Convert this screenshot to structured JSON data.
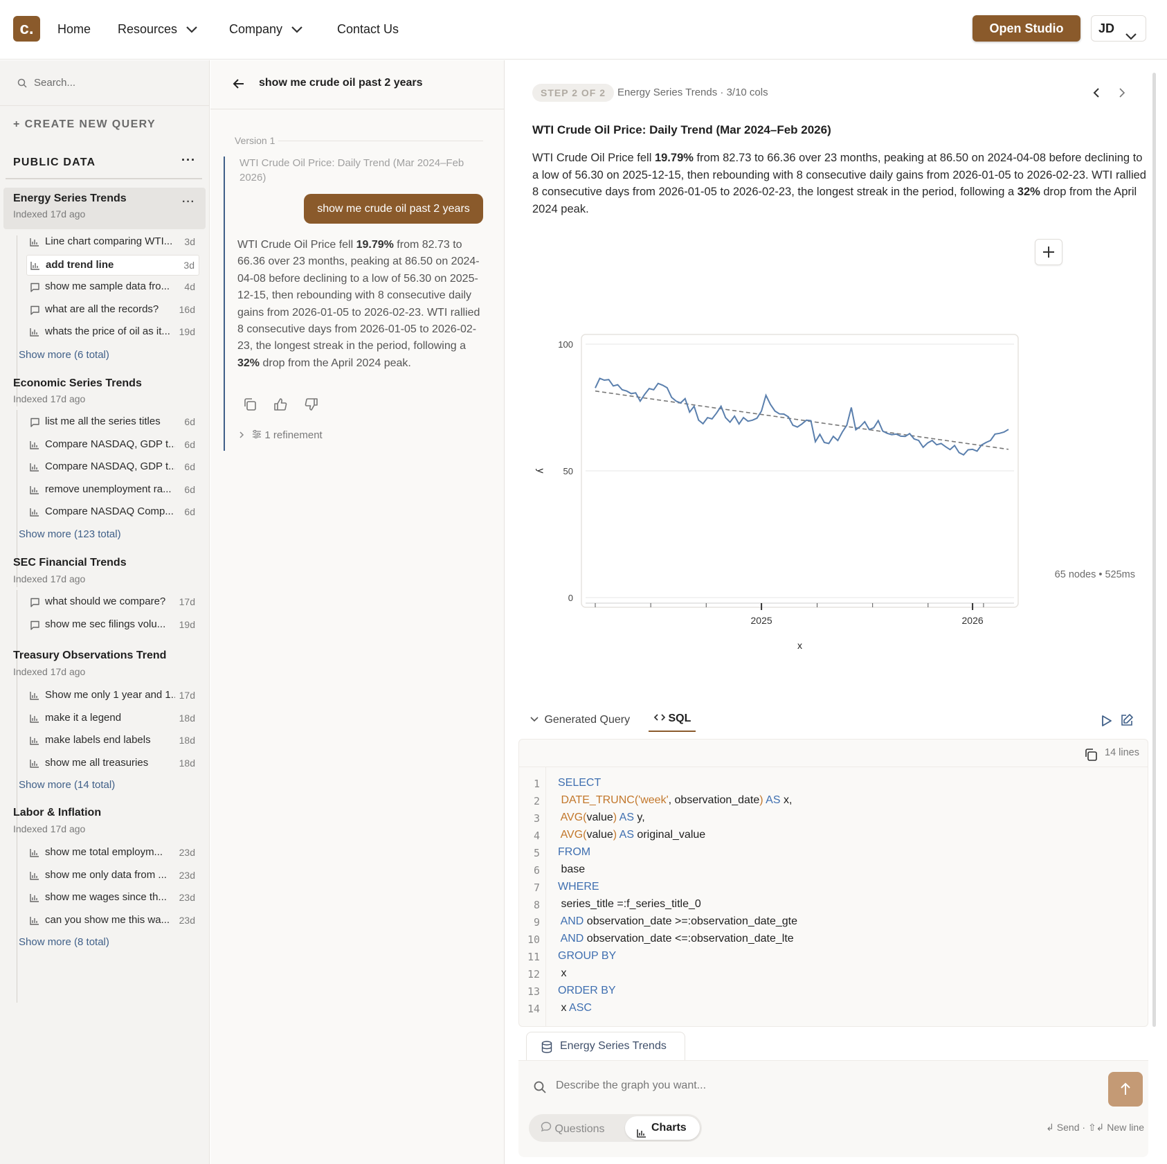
{
  "nav": {
    "logo": "c.",
    "home": "Home",
    "resources": "Resources",
    "company": "Company",
    "contact": "Contact Us",
    "open_studio": "Open Studio",
    "user_initials": "JD"
  },
  "sidebar": {
    "search_placeholder": "Search...",
    "create_label": "+ CREATE NEW QUERY",
    "section_title": "PUBLIC DATA",
    "section_more": "···",
    "groups": [
      {
        "title": "Energy Series Trends",
        "subtitle": "Indexed 17d ago",
        "more": "···",
        "items": [
          {
            "label": "Line chart comparing WTI...",
            "age": "3d",
            "icon": "chart-icon"
          },
          {
            "label": "add trend line",
            "age": "3d",
            "icon": "chart-icon"
          },
          {
            "label": "show me sample data fro...",
            "age": "4d",
            "icon": "comment-icon"
          },
          {
            "label": "what are all the records?",
            "age": "16d",
            "icon": "comment-icon"
          },
          {
            "label": "whats the price of oil as it...",
            "age": "19d",
            "icon": "chart-icon"
          }
        ],
        "show_more": "Show more (6 total)"
      },
      {
        "title": "Economic Series Trends",
        "subtitle": "Indexed 17d ago",
        "items": [
          {
            "label": "list me all the series titles",
            "age": "6d",
            "icon": "comment-icon"
          },
          {
            "label": "Compare NASDAQ, GDP t...",
            "age": "6d",
            "icon": "chart-icon"
          },
          {
            "label": "Compare NASDAQ, GDP t...",
            "age": "6d",
            "icon": "chart-icon"
          },
          {
            "label": "remove unemployment ra...",
            "age": "6d",
            "icon": "chart-icon"
          },
          {
            "label": "Compare NASDAQ Comp...",
            "age": "6d",
            "icon": "chart-icon"
          }
        ],
        "show_more": "Show more (123 total)"
      },
      {
        "title": "SEC Financial Trends",
        "subtitle": "Indexed 17d ago",
        "items": [
          {
            "label": "what should we compare?",
            "age": "17d",
            "icon": "comment-icon"
          },
          {
            "label": "show me sec filings volu...",
            "age": "19d",
            "icon": "comment-icon"
          }
        ]
      },
      {
        "title": "Treasury Observations Trend",
        "subtitle": "Indexed 17d ago",
        "items": [
          {
            "label": "Show me only 1 year and 1...",
            "age": "17d",
            "icon": "chart-icon"
          },
          {
            "label": "make it a legend",
            "age": "18d",
            "icon": "chart-icon"
          },
          {
            "label": "make labels end labels",
            "age": "18d",
            "icon": "chart-icon"
          },
          {
            "label": "show me all treasuries",
            "age": "18d",
            "icon": "chart-icon"
          }
        ],
        "show_more": "Show more (14 total)"
      },
      {
        "title": "Labor & Inflation",
        "subtitle": "Indexed 17d ago",
        "items": [
          {
            "label": "show me total employm...",
            "age": "23d",
            "icon": "chart-icon"
          },
          {
            "label": "show me only data from ...",
            "age": "23d",
            "icon": "chart-icon"
          },
          {
            "label": "show me wages since th...",
            "age": "23d",
            "icon": "chart-icon"
          },
          {
            "label": "can you show me this wa...",
            "age": "23d",
            "icon": "chart-icon"
          }
        ],
        "show_more": "Show more (8 total)"
      }
    ]
  },
  "thread": {
    "title": "show me crude oil past 2 years",
    "version": "Version 1",
    "chart_title": "WTI Crude Oil Price: Daily Trend (Mar 2024–Feb 2026)",
    "user_message": "show me crude oil past 2 years",
    "answer": {
      "p1": "WTI Crude Oil Price fell ",
      "b1": "19.79%",
      "p2": " from 82.73 to 66.36 over 23 months, peaking at 86.50 on 2024-04-08 before declining to a low of 56.30 on 2025-12-15, then rebounding with 8 consecutive daily gains from 2026-01-05 to 2026-02-23. WTI rallied 8 consecutive days from 2026-01-05 to 2026-02-23, the longest streak in the period, following a ",
      "b2": "32%",
      "p3": " drop from the April 2024 peak."
    },
    "refinement": "1 refinement"
  },
  "detail": {
    "step": "STEP 2 OF 2",
    "step_info": "Energy Series Trends · 3/10 cols",
    "title": "WTI Crude Oil Price: Daily Trend (Mar 2024–Feb 2026)",
    "stats": "65 nodes • 525ms"
  },
  "chart_data": {
    "type": "line",
    "title": "",
    "xlabel": "x",
    "ylabel": "y",
    "ylim": [
      0,
      100
    ],
    "yticks": [
      0,
      50,
      100
    ],
    "xticks": [
      "2025",
      "2026"
    ],
    "grid": true,
    "series": [
      {
        "values": [
          82.7,
          86.5,
          85.8,
          86.0,
          83.5,
          84.0,
          82.0,
          81.5,
          80.5,
          80.8,
          77.5,
          80.2,
          82.5,
          82.0,
          84.5,
          83.8,
          82.8,
          79.0,
          77.5,
          76.8,
          78.5,
          73.2,
          75.5,
          70.0,
          68.6,
          71.0,
          70.5,
          72.8,
          75.5,
          71.0,
          69.2,
          71.6,
          68.5,
          71.0,
          69.6,
          70.0,
          70.8,
          73.6,
          79.8,
          76.2,
          73.6,
          72.5,
          72.4,
          71.3,
          68.0,
          67.3,
          68.5,
          70.0,
          69.8,
          61.5,
          64.4,
          61.2,
          60.8,
          63.6,
          62.0,
          65.3,
          68.0,
          75.0,
          66.2,
          67.5,
          69.4,
          66.3,
          67.0,
          69.8,
          65.7,
          64.8,
          64.3,
          64.5,
          63.7,
          63.6,
          64.7,
          62.6,
          62.0,
          59.3,
          61.0,
          62.0,
          60.3,
          60.8,
          59.5,
          58.4,
          60.0,
          57.2,
          56.3,
          58.3,
          58.5,
          57.8,
          60.2,
          61.2,
          62.0,
          64.5,
          64.8,
          65.3,
          66.36
        ]
      },
      {
        "name": "trend",
        "values": [
          81.5,
          58.5
        ]
      }
    ]
  },
  "query": {
    "toggle_label": "Generated Query",
    "sql_tab": "SQL",
    "lines_label": "14 lines",
    "lines": [
      {
        "n": "1",
        "parts": [
          {
            "t": "SELECT",
            "c": "kw"
          }
        ]
      },
      {
        "n": "2",
        "parts": [
          {
            "t": " DATE_TRUNC(",
            "c": "fn"
          },
          {
            "t": "'week'",
            "c": "fn"
          },
          {
            "t": ", observation_date",
            "c": ""
          },
          {
            "t": ")",
            "c": "fn"
          },
          {
            "t": " AS",
            "c": "kw"
          },
          {
            "t": " x,",
            "c": ""
          }
        ]
      },
      {
        "n": "3",
        "parts": [
          {
            "t": " AVG(",
            "c": "fn"
          },
          {
            "t": "value",
            "c": ""
          },
          {
            "t": ")",
            "c": "fn"
          },
          {
            "t": " AS",
            "c": "kw"
          },
          {
            "t": " y,",
            "c": ""
          }
        ]
      },
      {
        "n": "4",
        "parts": [
          {
            "t": " AVG(",
            "c": "fn"
          },
          {
            "t": "value",
            "c": ""
          },
          {
            "t": ")",
            "c": "fn"
          },
          {
            "t": " AS",
            "c": "kw"
          },
          {
            "t": " original_value",
            "c": ""
          }
        ]
      },
      {
        "n": "5",
        "parts": [
          {
            "t": "FROM",
            "c": "kw"
          }
        ]
      },
      {
        "n": "6",
        "parts": [
          {
            "t": " base",
            "c": ""
          }
        ]
      },
      {
        "n": "7",
        "parts": [
          {
            "t": "WHERE",
            "c": "kw"
          }
        ]
      },
      {
        "n": "8",
        "parts": [
          {
            "t": " series_title =:f_series_title_0",
            "c": ""
          }
        ]
      },
      {
        "n": "9",
        "parts": [
          {
            "t": " AND",
            "c": "kw"
          },
          {
            "t": " observation_date >=:observation_date_gte",
            "c": ""
          }
        ]
      },
      {
        "n": "10",
        "parts": [
          {
            "t": " AND",
            "c": "kw"
          },
          {
            "t": " observation_date <=:observation_date_lte",
            "c": ""
          }
        ]
      },
      {
        "n": "11",
        "parts": [
          {
            "t": "GROUP BY",
            "c": "kw"
          }
        ]
      },
      {
        "n": "12",
        "parts": [
          {
            "t": " x",
            "c": ""
          }
        ]
      },
      {
        "n": "13",
        "parts": [
          {
            "t": "ORDER BY",
            "c": "kw"
          }
        ]
      },
      {
        "n": "14",
        "parts": [
          {
            "t": " x",
            "c": ""
          },
          {
            "t": " ASC",
            "c": "kw"
          }
        ]
      }
    ]
  },
  "composer": {
    "source_tab": "Energy Series Trends",
    "placeholder": "Describe the graph you want...",
    "mode_questions": "Questions",
    "mode_charts": "Charts",
    "hint": "↲ Send · ⇧↲ New line"
  },
  "colors": {
    "brand": "#8a5a2b",
    "brand_light": "#c49a75",
    "link": "#3f5f88",
    "series": "#5a7fad"
  }
}
